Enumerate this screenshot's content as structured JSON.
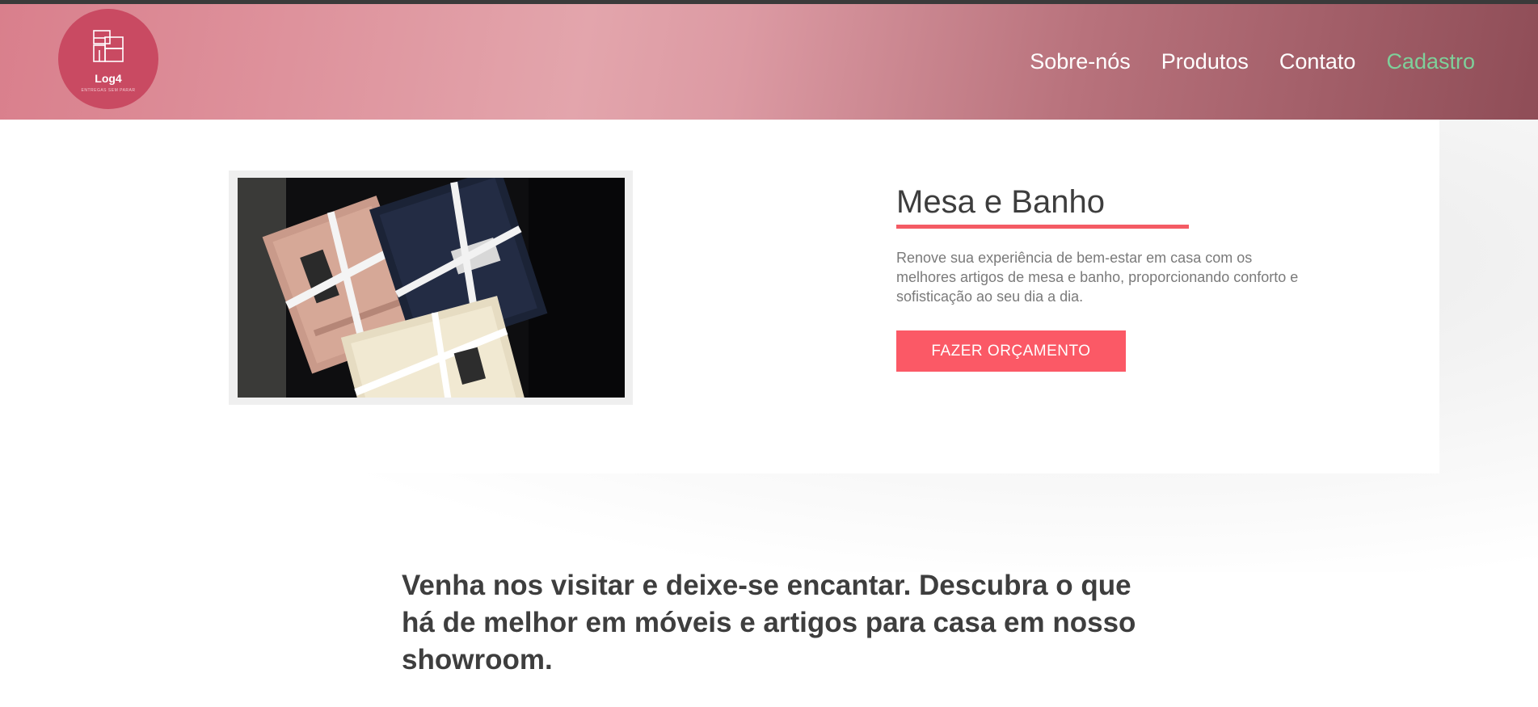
{
  "brand": {
    "name": "Log4",
    "tagline": "ENTREGAS SEM PARAR",
    "logo_icon": "stacked-boxes-icon",
    "logo_color": "#c94a62"
  },
  "nav": {
    "items": [
      {
        "label": "Sobre-nós",
        "active": false
      },
      {
        "label": "Produtos",
        "active": false
      },
      {
        "label": "Contato",
        "active": false
      },
      {
        "label": "Cadastro",
        "active": true
      }
    ],
    "active_color": "#7ed09a"
  },
  "feature": {
    "title": "Mesa e Banho",
    "description": "Renove sua experiência de bem-estar em casa com os melhores artigos de mesa e banho, proporcionando conforto e sofisticação ao seu dia a dia.",
    "cta_label": "FAZER ORÇAMENTO",
    "accent_color": "#fb5966"
  },
  "visit": {
    "text": "Venha nos visitar e deixe-se encantar. Descubra o que há de melhor em móveis e artigos para casa em nosso showroom."
  }
}
